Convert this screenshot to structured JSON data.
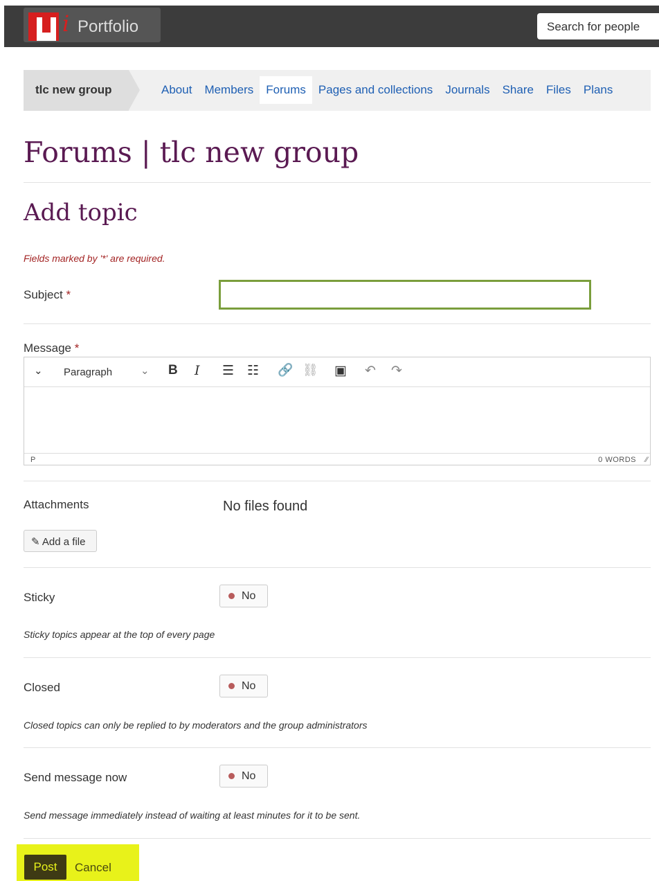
{
  "header": {
    "logo_text": "Portfolio",
    "logo_i": "i",
    "search_placeholder": "Search for people"
  },
  "group_nav": {
    "group_name": "tlc new group",
    "links": [
      {
        "label": "About",
        "active": false
      },
      {
        "label": "Members",
        "active": false
      },
      {
        "label": "Forums",
        "active": true
      },
      {
        "label": "Pages and collections",
        "active": false
      },
      {
        "label": "Journals",
        "active": false
      },
      {
        "label": "Share",
        "active": false
      },
      {
        "label": "Files",
        "active": false
      },
      {
        "label": "Plans",
        "active": false
      }
    ]
  },
  "page": {
    "title": "Forums | tlc new group",
    "subtitle": "Add topic",
    "required_note": "Fields marked by '*' are required."
  },
  "form": {
    "subject_label": "Subject",
    "required_star": "*",
    "subject_value": "",
    "message_label": "Message",
    "editor": {
      "block_format": "Paragraph",
      "status_path": "P",
      "word_count": "0 WORDS"
    },
    "attachments_label": "Attachments",
    "no_files": "No files found",
    "add_file": "Add a file",
    "sticky": {
      "label": "Sticky",
      "value": "No",
      "description": "Sticky topics appear at the top of every page"
    },
    "closed": {
      "label": "Closed",
      "value": "No",
      "description": "Closed topics can only be replied to by moderators and the group administrators"
    },
    "send_now": {
      "label": "Send message now",
      "value": "No",
      "description": "Send message immediately instead of waiting at least minutes for it to be sent."
    },
    "post": "Post",
    "cancel": "Cancel"
  },
  "colors": {
    "brand_red": "#d61f1f",
    "title_purple": "#5a1a52",
    "link_blue": "#1e5fb3",
    "highlight_yellow": "#e8f21a",
    "input_focus_green": "#7a9e3c"
  }
}
